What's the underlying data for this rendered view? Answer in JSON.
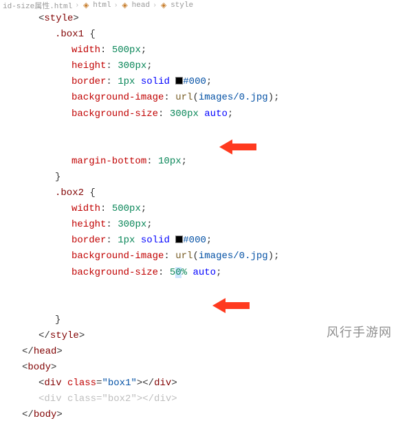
{
  "breadcrumb": {
    "file": "id-size属性.html",
    "path": [
      "html",
      "head",
      "style"
    ]
  },
  "css_rules": [
    {
      "selector": ".box1",
      "declarations": [
        {
          "property": "width",
          "value": "500px"
        },
        {
          "property": "height",
          "value": "300px"
        },
        {
          "property": "border",
          "value": "1px solid #000",
          "has_color_swatch": true,
          "color": "#000"
        },
        {
          "property": "background-image",
          "value": "url(images/0.jpg)"
        },
        {
          "property": "background-size",
          "value": "300px auto",
          "highlighted": true
        },
        {
          "property": "margin-bottom",
          "value": "10px"
        }
      ]
    },
    {
      "selector": ".box2",
      "declarations": [
        {
          "property": "width",
          "value": "500px"
        },
        {
          "property": "height",
          "value": "300px"
        },
        {
          "property": "border",
          "value": "1px solid #000",
          "has_color_swatch": true,
          "color": "#000"
        },
        {
          "property": "background-image",
          "value": "url(images/0.jpg)"
        },
        {
          "property": "background-size",
          "value": "50% auto",
          "highlighted": true,
          "caret_in_token": true
        }
      ]
    }
  ],
  "html_body": {
    "divs": [
      {
        "class": "box1",
        "muted": false
      },
      {
        "class": "box2",
        "muted": true
      }
    ]
  },
  "tags": {
    "style_open": "<style>",
    "style_close": "</style>",
    "head_close": "</head>",
    "body_open": "<body>",
    "body_close": "</body>"
  },
  "watermark": "风行手游网",
  "annotations": {
    "arrow_color": "#ff3a1f"
  }
}
